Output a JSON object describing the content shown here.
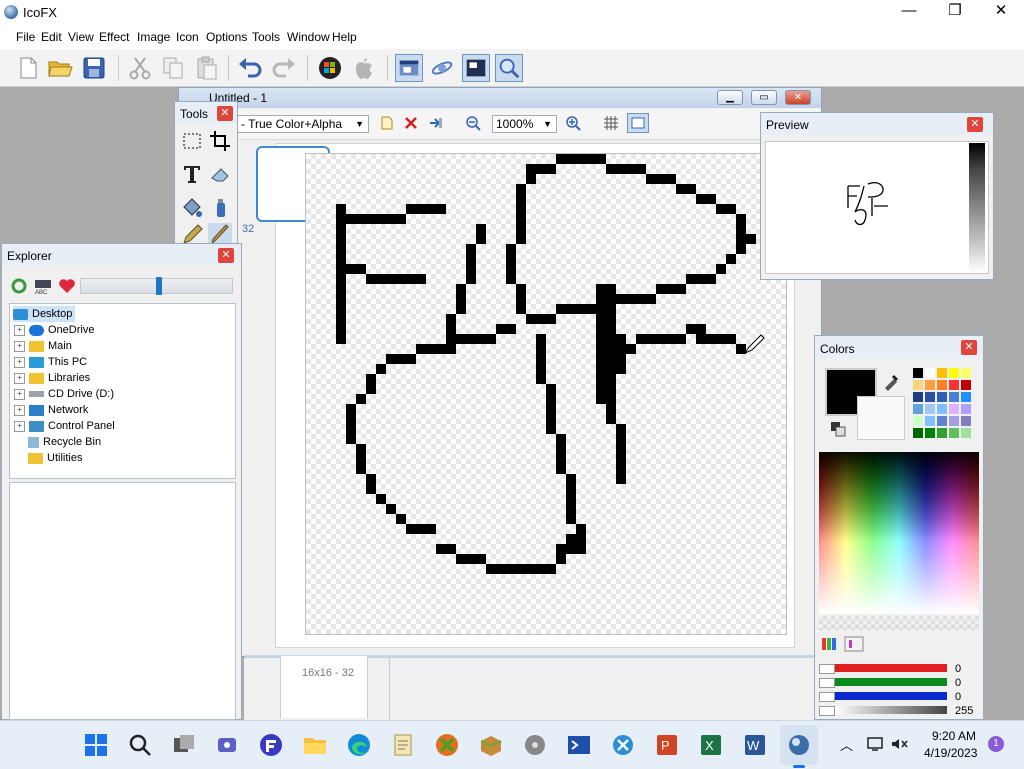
{
  "app": {
    "title": "IcoFX"
  },
  "menu": [
    "File",
    "Edit",
    "View",
    "Effect",
    "Image",
    "Icon",
    "Options",
    "Tools",
    "Window",
    "Help"
  ],
  "document": {
    "title": "Untitled - 1",
    "color_mode": "- True Color+Alpha",
    "zoom": "1000%",
    "thumb_label": "32",
    "thumb_label2": "16x16 - 32"
  },
  "tools_panel": {
    "title": "Tools"
  },
  "preview_panel": {
    "title": "Preview"
  },
  "explorer": {
    "title": "Explorer",
    "items": [
      {
        "label": "Desktop",
        "icon": "desktop-icon",
        "color": "#2f8fd6"
      },
      {
        "label": "OneDrive",
        "icon": "cloud-icon",
        "color": "#1a73d6"
      },
      {
        "label": "Main",
        "icon": "folder-icon",
        "color": "#f1c232"
      },
      {
        "label": "This PC",
        "icon": "pc-icon",
        "color": "#2b9bd8"
      },
      {
        "label": "Libraries",
        "icon": "folder-icon",
        "color": "#f1c232"
      },
      {
        "label": "CD Drive (D:)",
        "icon": "cd-drive-icon",
        "color": "#9aa3ad"
      },
      {
        "label": "Network",
        "icon": "network-icon",
        "color": "#2b7fc6"
      },
      {
        "label": "Control Panel",
        "icon": "control-panel-icon",
        "color": "#3c8dc8"
      },
      {
        "label": "Recycle Bin",
        "icon": "recycle-bin-icon",
        "color": "#8eb7d8"
      },
      {
        "label": "Utilities",
        "icon": "folder-icon",
        "color": "#f1c232"
      }
    ]
  },
  "colors_panel": {
    "title": "Colors",
    "primary_color": "#000000",
    "values": [
      "0",
      "0",
      "0",
      "255"
    ],
    "swatches": [
      [
        "#000000",
        "#ffffff",
        "#ffc000",
        "#ffff00",
        "#ffff66"
      ],
      [
        "#ffd27f",
        "#ff9f40",
        "#ff7f27",
        "#ff3030",
        "#c00000"
      ],
      [
        "#1f3f7f",
        "#2f4f9f",
        "#305fb8",
        "#4a7fd8",
        "#1e90ff"
      ],
      [
        "#5fa3d8",
        "#9fc8f0",
        "#7fbfff",
        "#e0b0ff",
        "#b0a0ff"
      ],
      [
        "#ccffcc",
        "#80c0ff",
        "#6080d0",
        "#a0a0e0",
        "#8080c0"
      ],
      [
        "#006600",
        "#008000",
        "#30a030",
        "#60c060",
        "#a0e0a0"
      ]
    ]
  },
  "taskbar": {
    "time": "9:20 AM",
    "date": "4/19/2023",
    "notification_count": "1"
  }
}
